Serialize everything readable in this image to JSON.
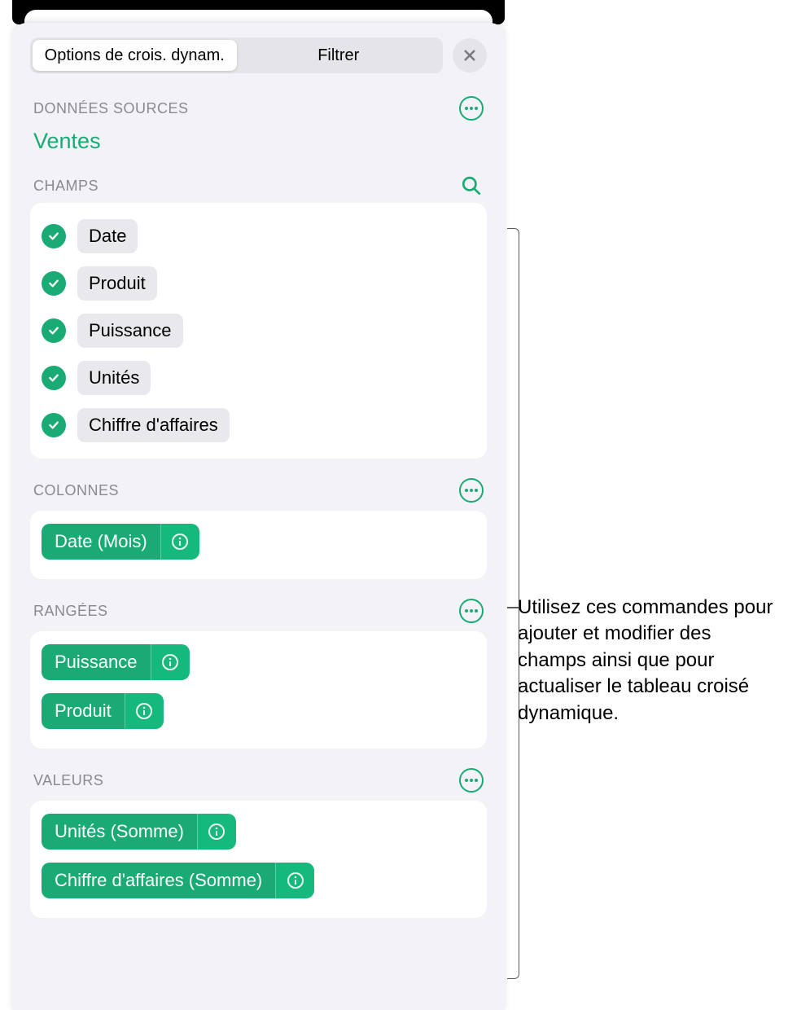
{
  "tabs": {
    "options": "Options de crois. dynam.",
    "filter": "Filtrer"
  },
  "sections": {
    "sourceData": "DONNÉES SOURCES",
    "fields": "CHAMPS",
    "columns": "COLONNES",
    "rows": "RANGÉES",
    "values": "VALEURS"
  },
  "sourceName": "Ventes",
  "fields": [
    {
      "label": "Date"
    },
    {
      "label": "Produit"
    },
    {
      "label": "Puissance"
    },
    {
      "label": "Unités"
    },
    {
      "label": "Chiffre d'affaires"
    }
  ],
  "columns": [
    {
      "label": "Date (Mois)"
    }
  ],
  "rows": [
    {
      "label": "Puissance"
    },
    {
      "label": "Produit"
    }
  ],
  "values": [
    {
      "label": "Unités (Somme)"
    },
    {
      "label": "Chiffre d'affaires (Somme)"
    }
  ],
  "callout": "Utilisez ces commandes pour ajouter et modifier des champs ainsi que pour actualiser le tableau croisé dynamique."
}
